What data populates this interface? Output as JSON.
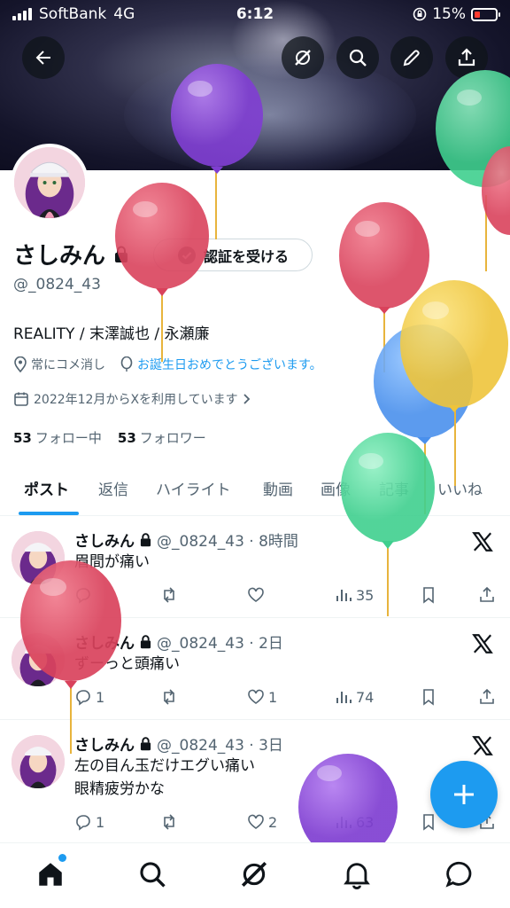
{
  "status_bar": {
    "carrier": "SoftBank",
    "network": "4G",
    "time": "6:12",
    "battery": "15%"
  },
  "profile": {
    "name": "さしみん",
    "handle": "@_0824_43",
    "verify_button": "認証を受ける",
    "bio": "REALITY / 末澤誠也 / 永瀬廉",
    "location": "常にコメ消し",
    "website": "お誕生日おめでとうございます。",
    "joined": "2022年12月からXを利用しています",
    "following_count": "53",
    "following_label": "フォロー中",
    "followers_count": "53",
    "followers_label": "フォロワー"
  },
  "tabs": [
    {
      "label": "ポスト"
    },
    {
      "label": "返信"
    },
    {
      "label": "ハイライト"
    },
    {
      "label": "動画"
    },
    {
      "label": "画像"
    },
    {
      "label": "記事"
    },
    {
      "label": "いいね"
    }
  ],
  "posts": [
    {
      "name": "さしみん",
      "meta": "@_0824_43 · 8時間",
      "text": "眉間が痛い",
      "replies": "",
      "reposts": "",
      "likes": "",
      "views": "35"
    },
    {
      "name": "さしみん",
      "meta": "@_0824_43 · 2日",
      "text": "ずーっと頭痛い",
      "replies": "1",
      "reposts": "",
      "likes": "1",
      "views": "74"
    },
    {
      "name": "さしみん",
      "meta": "@_0824_43 · 3日",
      "text": "左の目ん玉だけエグい痛い",
      "text2": "眼精疲労かな",
      "replies": "1",
      "reposts": "",
      "likes": "2",
      "views": "63"
    }
  ],
  "icons": [
    "back-arrow-icon",
    "grok-icon",
    "search-icon",
    "edit-icon",
    "share-icon",
    "lock-icon",
    "verified-badge-icon",
    "location-icon",
    "balloon-icon",
    "calendar-icon",
    "reply-icon",
    "repost-icon",
    "like-icon",
    "views-icon",
    "bookmark-icon",
    "x-logo-icon",
    "plus-icon",
    "home-icon",
    "bell-icon",
    "messages-icon"
  ],
  "colors": {
    "accent": "#1d9bf0",
    "text": "#0f1419",
    "muted": "#536471"
  }
}
